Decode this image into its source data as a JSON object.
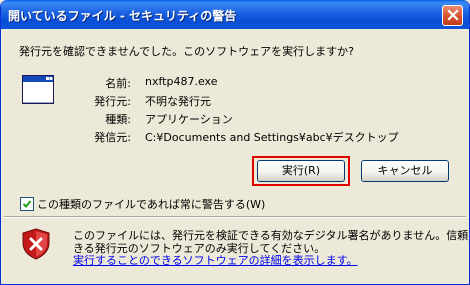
{
  "window": {
    "title": "開いているファイル - セキュリティの警告"
  },
  "dialog": {
    "question": "発行元を確認できませんでした。このソフトウェアを実行しますか?",
    "fields": [
      {
        "label": "名前:",
        "value": "nxftp487.exe"
      },
      {
        "label": "発行元:",
        "value": "不明な発行元"
      },
      {
        "label": "種類:",
        "value": "アプリケーション"
      },
      {
        "label": "発信元:",
        "value": "C:¥Documents and Settings¥abc¥デスクトップ"
      }
    ],
    "buttons": {
      "run": "実行(R)",
      "cancel": "キャンセル"
    },
    "checkbox": {
      "label": "この種類のファイルであれば常に警告する(W)",
      "checked": true
    },
    "info": {
      "line1": "このファイルには、発行元を検証できる有効なデジタル署名がありません。信頼で",
      "line2": "きる発行元のソフトウェアのみ実行してください。",
      "link": "実行することのできるソフトウェアの詳細を表示します。"
    }
  }
}
